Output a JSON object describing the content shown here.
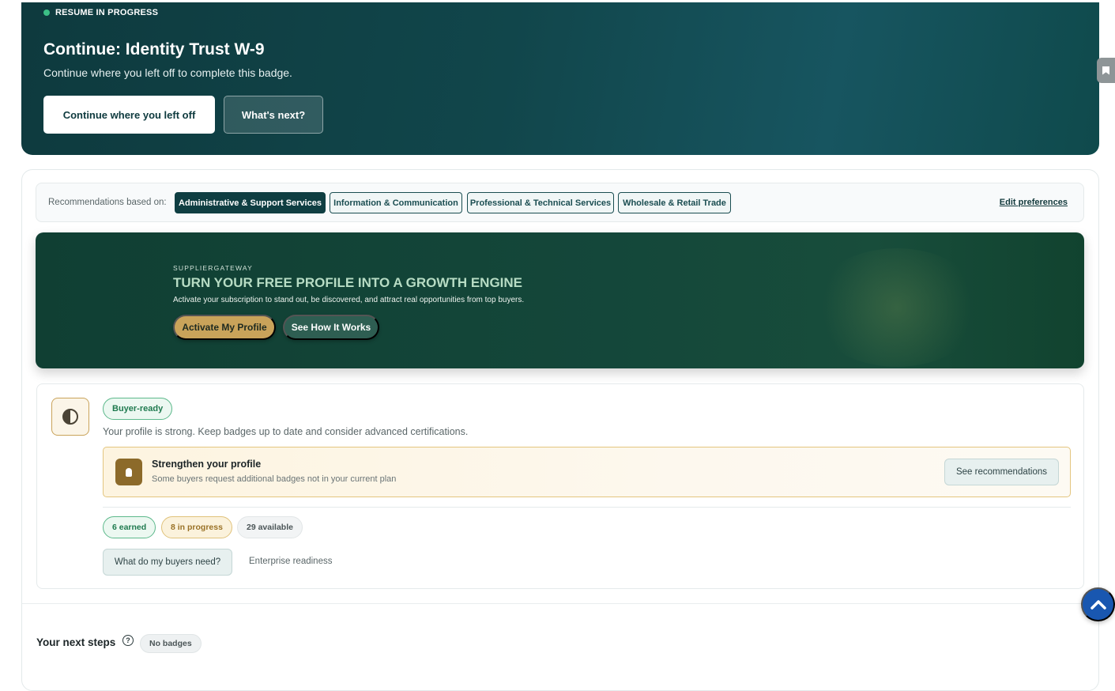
{
  "resume": {
    "status": "RESUME IN PROGRESS",
    "title": "Continue: Identity Trust W-9",
    "subtitle": "Continue where you left off to complete this badge.",
    "continue_label": "Continue where you left off",
    "whats_next_label": "What's next?"
  },
  "recommendations": {
    "label": "Recommendations based on:",
    "categories": [
      {
        "label": "Administrative & Support Services",
        "active": true
      },
      {
        "label": "Information & Communication",
        "active": false
      },
      {
        "label": "Professional & Technical Services",
        "active": false
      },
      {
        "label": "Wholesale & Retail Trade",
        "active": false
      }
    ],
    "edit_label": "Edit preferences"
  },
  "growth": {
    "kicker": "SUPPLIERGATEWAY",
    "title": "TURN YOUR FREE PROFILE INTO A GROWTH ENGINE",
    "subtitle": "Activate your subscription to stand out, be discovered, and attract real opportunities from top buyers.",
    "activate_label": "Activate My Profile",
    "how_label": "See How It Works"
  },
  "status_card": {
    "badge": "Buyer-ready",
    "description": "Your profile is strong. Keep badges up to date and consider advanced certifications.",
    "strengthen": {
      "title": "Strengthen your profile",
      "subtitle": "Some buyers request additional badges not in your current plan",
      "button": "See recommendations"
    },
    "counts": {
      "earned": "6 earned",
      "in_progress": "8 in progress",
      "available": "29 available"
    },
    "buyers_button": "What do my buyers need?",
    "enterprise_link": "Enterprise readiness"
  },
  "next_steps": {
    "title": "Your next steps",
    "help": "?",
    "badge": "No badges"
  },
  "icons": {
    "bookmark": "bookmark-icon",
    "half_circle": "half-circle-icon",
    "lightbulb": "lightbulb-icon",
    "help": "help-circle-icon",
    "scroll_top": "chevron-up-icon"
  },
  "colors": {
    "primary_dark": "#0f3e42",
    "banner_green": "#14473a",
    "gold": "#c9a35a",
    "success": "#1f7a4f",
    "scroll_blue": "#1957b0"
  }
}
